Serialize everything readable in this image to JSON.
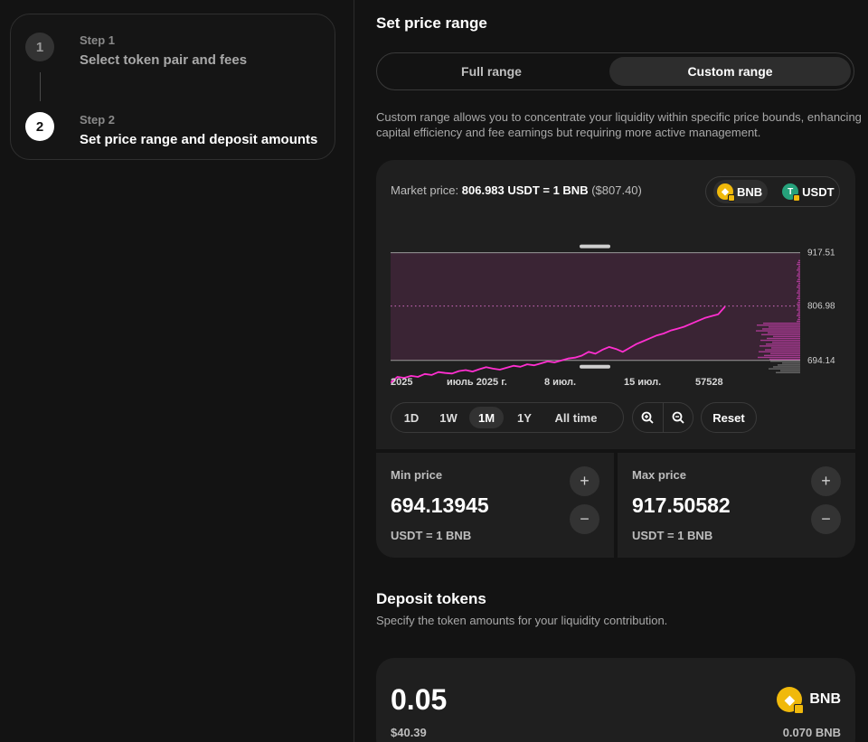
{
  "steps": [
    {
      "label": "Step 1",
      "title": "Select token pair and fees",
      "number": "1"
    },
    {
      "label": "Step 2",
      "title": "Set price range and deposit amounts",
      "number": "2"
    }
  ],
  "price_range": {
    "title": "Set price range",
    "toggle": {
      "full": "Full range",
      "custom": "Custom range",
      "selected": "custom"
    },
    "description": "Custom range allows you to concentrate your liquidity within specific price bounds, enhancing capital efficiency and fee earnings but requiring more active management."
  },
  "market": {
    "label": "Market price:",
    "value": "806.983 USDT = 1 BNB",
    "usd": "($807.40)"
  },
  "tokens": [
    {
      "symbol": "BNB",
      "icon": "bnb-coin-icon",
      "selected": true
    },
    {
      "symbol": "USDT",
      "icon": "usdt-coin-icon",
      "selected": false
    }
  ],
  "chart_data": {
    "type": "line",
    "y_ticks": [
      "917.51",
      "806.98",
      "694.14"
    ],
    "x_ticks": [
      "2025",
      "июль 2025 г.",
      "8 июл.",
      "15 июл.",
      "57528"
    ],
    "range_max": 917.51,
    "range_min": 694.14,
    "current": 806.98,
    "ylim": [
      645,
      945
    ],
    "series": [
      {
        "values": [
          648,
          660,
          658,
          662,
          660,
          666,
          664,
          670,
          668,
          667,
          672,
          674,
          671,
          676,
          680,
          677,
          675,
          679,
          683,
          681,
          686,
          684,
          688,
          692,
          690,
          694,
          698,
          700,
          704,
          712,
          708,
          716,
          722,
          718,
          712,
          720,
          728,
          734,
          740,
          746,
          750,
          756,
          760,
          764,
          770,
          776,
          782,
          786,
          790,
          806
        ]
      }
    ],
    "colors": {
      "line": "#ff2fd0",
      "range_fill": "#3a2434",
      "current_line": "#d06bbf"
    }
  },
  "timeframes": {
    "items": [
      "1D",
      "1W",
      "1M",
      "1Y",
      "All time"
    ],
    "selected": "1M",
    "reset": "Reset"
  },
  "min_price": {
    "label": "Min price",
    "value": "694.13945",
    "unit": "USDT = 1 BNB"
  },
  "max_price": {
    "label": "Max price",
    "value": "917.50582",
    "unit": "USDT = 1 BNB"
  },
  "deposit": {
    "title": "Deposit tokens",
    "description": "Specify the token amounts for your liquidity contribution.",
    "amount": "0.05",
    "usd": "$40.39",
    "token": "BNB",
    "balance": "0.070 BNB"
  }
}
